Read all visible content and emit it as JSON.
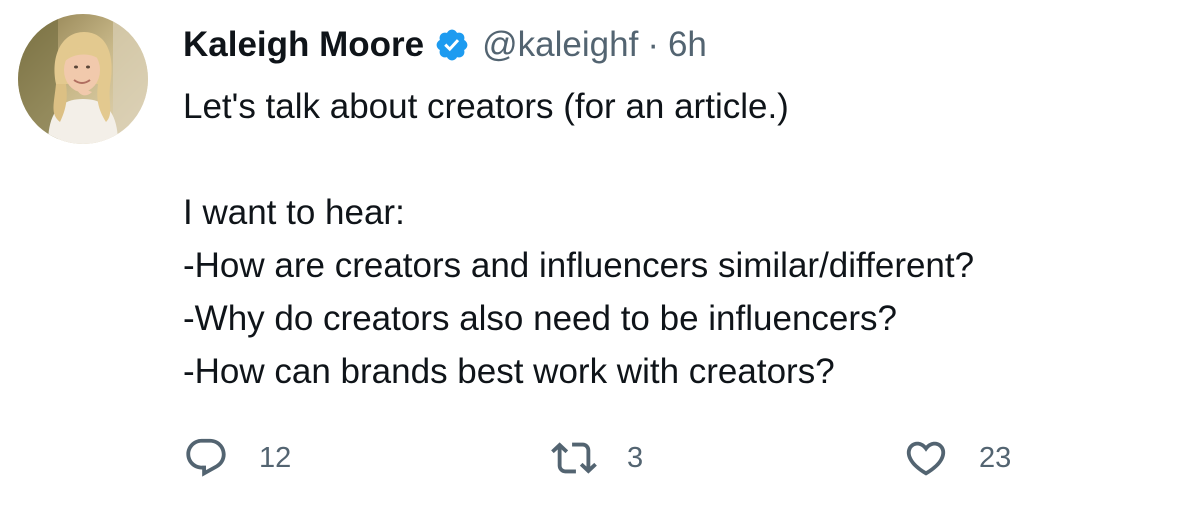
{
  "tweet": {
    "author": {
      "name": "Kaleigh Moore",
      "handle": "@kaleighf",
      "separator": "·",
      "time": "6h",
      "verified": true,
      "avatar_icon": "profile-photo"
    },
    "text_lines": [
      "Let's talk about creators (for an article.)",
      "",
      "I want to hear:",
      "-How are creators and influencers similar/different?",
      "-Why do creators also need to be influencers?",
      "-How can brands best work with creators?"
    ],
    "actions": {
      "reply": {
        "icon": "reply-icon",
        "count": "12"
      },
      "retweet": {
        "icon": "retweet-icon",
        "count": "3"
      },
      "like": {
        "icon": "heart-icon",
        "count": "23"
      }
    },
    "colors": {
      "text": "#0f1419",
      "secondary": "#536471",
      "verified": "#1d9bf0"
    }
  }
}
